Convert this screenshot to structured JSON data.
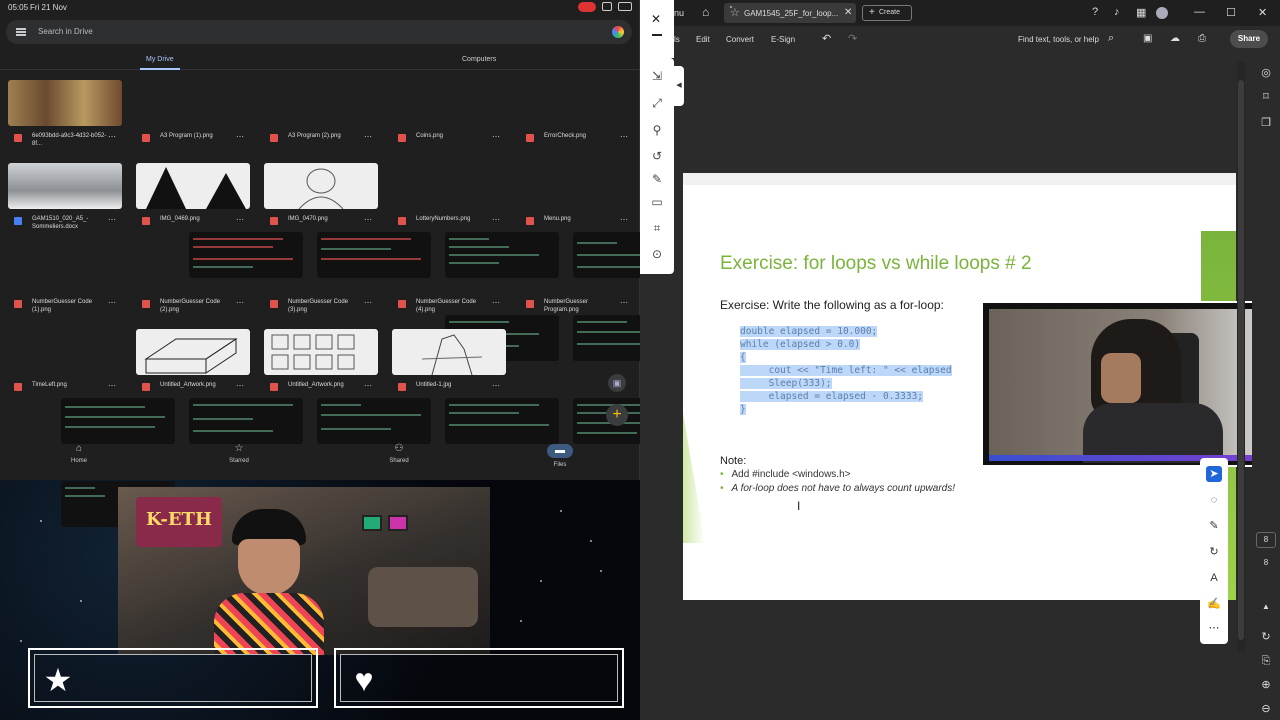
{
  "status_bar": {
    "time": "05:05",
    "date": "Fri 21 Nov"
  },
  "drive": {
    "search_placeholder": "Search in Drive",
    "tabs": [
      "My Drive",
      "Computers"
    ],
    "files": [
      {
        "name": "6e093bdd-a9c3-4d32-b052-8f...",
        "type": "image"
      },
      {
        "name": "A3 Program (1).png",
        "type": "image"
      },
      {
        "name": "A3 Program (2).png",
        "type": "image"
      },
      {
        "name": "Coins.png",
        "type": "image"
      },
      {
        "name": "ErrorCheck.png",
        "type": "image"
      },
      {
        "name": "GAM1510_020_A5_-Sommeliers.docx",
        "type": "docx"
      },
      {
        "name": "IMG_0469.png",
        "type": "image"
      },
      {
        "name": "IMG_0470.png",
        "type": "image"
      },
      {
        "name": "LotteryNumbers.png",
        "type": "image"
      },
      {
        "name": "Menu.png",
        "type": "image"
      },
      {
        "name": "NumberGuesser Code (1).png",
        "type": "image"
      },
      {
        "name": "NumberGuesser Code (2).png",
        "type": "image"
      },
      {
        "name": "NumberGuesser Code (3).png",
        "type": "image"
      },
      {
        "name": "NumberGuesser Code (4).png",
        "type": "image"
      },
      {
        "name": "NumberGuesser Program.png",
        "type": "image"
      },
      {
        "name": "TimeLeft.png",
        "type": "image"
      },
      {
        "name": "Untitled_Artwork.png",
        "type": "image"
      },
      {
        "name": "Untitled_Artwork.png",
        "type": "image"
      },
      {
        "name": "Untitled-1.jpg",
        "type": "image"
      }
    ],
    "more_label": "⋯",
    "bottom_nav": [
      "Home",
      "Starred",
      "Shared",
      "Files"
    ],
    "fab_icon": "+"
  },
  "radio": {
    "logo": "K-ETH"
  },
  "acrobat": {
    "menu_partial": "nu",
    "tab_title": "GAM1545_25F_for_loop...",
    "create_label": "Create",
    "menus": [
      "ls",
      "Edit",
      "Convert",
      "E-Sign"
    ],
    "find_label": "Find text, tools, or help",
    "share_label": "Share",
    "page_numbers": [
      "8",
      "8"
    ]
  },
  "slide": {
    "title": "Exercise: for loops vs while loops # 2",
    "subtitle": "Exercise:  Write the following as a for-loop:",
    "code": [
      "double elapsed = 10.000;",
      "while (elapsed > 0.0)",
      "{",
      "     cout << \"Time left: \" << elapsed",
      "     Sleep(333);",
      "     elapsed = elapsed - 0.3333;",
      "}"
    ],
    "note_label": "Note:",
    "bullets": [
      "Add #include <windows.h>",
      "A for-loop does not have to always count upwards!"
    ]
  },
  "colors": {
    "accent_green": "#7ab43c",
    "drive_bg": "#1f1f1f",
    "acrobat_bg": "#2b2b2b"
  }
}
